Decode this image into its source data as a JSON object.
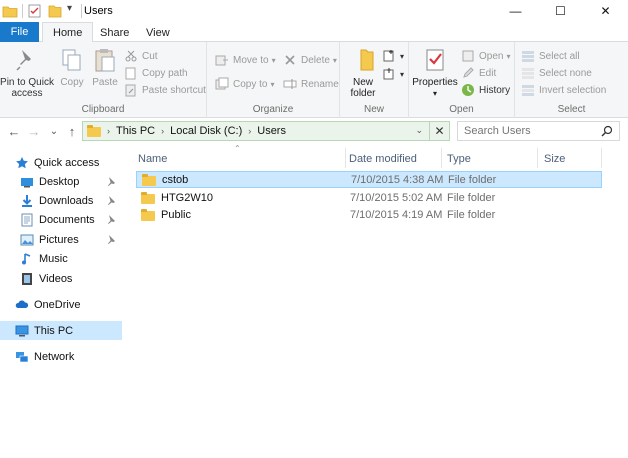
{
  "window": {
    "title": "Users",
    "minimize_glyph": "—",
    "maximize_glyph": "☐",
    "close_glyph": "✕"
  },
  "qat": {
    "dropdown_glyph": "▾"
  },
  "ribbon_tabs": {
    "file": "File",
    "home": "Home",
    "share": "Share",
    "view": "View"
  },
  "ribbon": {
    "clipboard": {
      "label": "Clipboard",
      "pin_label_1": "Pin to Quick",
      "pin_label_2": "access",
      "copy": "Copy",
      "paste": "Paste",
      "cut": "Cut",
      "copy_path": "Copy path",
      "paste_shortcut": "Paste shortcut"
    },
    "organize": {
      "label": "Organize",
      "move_to": "Move to",
      "copy_to": "Copy to",
      "delete": "Delete",
      "rename": "Rename"
    },
    "new": {
      "label": "New",
      "new_folder_1": "New",
      "new_folder_2": "folder"
    },
    "open": {
      "label": "Open",
      "properties": "Properties",
      "open": "Open",
      "edit": "Edit",
      "history": "History"
    },
    "select": {
      "label": "Select",
      "select_all": "Select all",
      "select_none": "Select none",
      "invert_selection": "Invert selection"
    }
  },
  "address": {
    "crumbs": [
      "This PC",
      "Local Disk (C:)",
      "Users"
    ],
    "search_placeholder": "Search Users"
  },
  "nav": {
    "back_glyph": "←",
    "forward_glyph": "→",
    "recent_glyph": "⌄",
    "up_glyph": "↑",
    "items": [
      {
        "label": "Quick access",
        "icon": "star-icon",
        "pinned": false,
        "selected": false
      },
      {
        "label": "Desktop",
        "icon": "desktop-icon",
        "pinned": true,
        "selected": false
      },
      {
        "label": "Downloads",
        "icon": "download-icon",
        "pinned": true,
        "selected": false
      },
      {
        "label": "Documents",
        "icon": "documents-icon",
        "pinned": true,
        "selected": false
      },
      {
        "label": "Pictures",
        "icon": "pictures-icon",
        "pinned": true,
        "selected": false
      },
      {
        "label": "Music",
        "icon": "music-icon",
        "pinned": false,
        "selected": false
      },
      {
        "label": "Videos",
        "icon": "videos-icon",
        "pinned": false,
        "selected": false
      },
      {
        "label": "OneDrive",
        "icon": "cloud-icon",
        "pinned": false,
        "selected": false
      },
      {
        "label": "This PC",
        "icon": "computer-icon",
        "pinned": false,
        "selected": true
      },
      {
        "label": "Network",
        "icon": "network-icon",
        "pinned": false,
        "selected": false
      }
    ]
  },
  "files": {
    "columns": [
      "Name",
      "Date modified",
      "Type",
      "Size"
    ],
    "rows": [
      {
        "name": "cstob",
        "date": "7/10/2015 4:38 AM",
        "type": "File folder",
        "size": "",
        "selected": true
      },
      {
        "name": "HTG2W10",
        "date": "7/10/2015 5:02 AM",
        "type": "File folder",
        "size": "",
        "selected": false
      },
      {
        "name": "Public",
        "date": "7/10/2015 4:19 AM",
        "type": "File folder",
        "size": "",
        "selected": false
      }
    ]
  },
  "colors": {
    "file_tab": "#1979ca",
    "selection": "#cce8ff",
    "folder": "#f4c94e",
    "address_bg": "#eaf4ea"
  }
}
